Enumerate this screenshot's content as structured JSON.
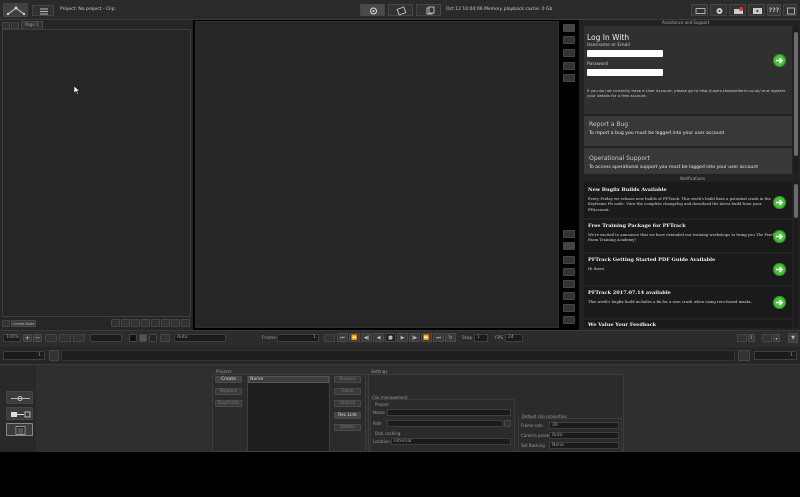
{
  "title_bar": {
    "project_label": "Project: No project - Clip:",
    "status": "Oct 12 10:04:06 Memory playback cache: 0 Gb"
  },
  "left_panel": {
    "tab_label": "Page 1",
    "create_button": "Create Node"
  },
  "side_panel": {
    "header_top": "Assistance and Support",
    "login": {
      "title": "Log In With",
      "username_label": "Username or Email",
      "password_label": "Password",
      "info_text": "If you do not currently have a User Account, please go to http://users.thepixelfarm.co.uk/ and register your details for a free account."
    },
    "report_bug": {
      "title": "Report a Bug",
      "text": "To report a bug you must be logged into your user account"
    },
    "op_support": {
      "title": "Operational Support",
      "text": "To access operational support you must be logged into your user account"
    },
    "header_notifications": "Notifications",
    "notifications": [
      {
        "title": "New Bugfix Builds Available",
        "body": "Every Friday we release new builds of PFTrack. This week's build fixes a potential crash in the Keyframe Fit node. View the complete changelog and download the latest build from your PFAccount."
      },
      {
        "title": "Free Training Package for PFTrack",
        "body": "We're excited to announce that we have extended our training workshops to bring you The Pixel Farm Training Academy!"
      },
      {
        "title": "PFTrack Getting Started PDF Guide Available",
        "body": "Hi there,"
      },
      {
        "title": "PFTrack 2017.07.14 available",
        "body": "This week's bugfix build includes a fix for a rare crash when using roto-based masks."
      },
      {
        "title": "We Value Your Feedback",
        "body": ""
      }
    ]
  },
  "playback_bar": {
    "zoom": "100%",
    "mode_select": "Auto",
    "frame_label": "Frame",
    "frame_value": "1",
    "step_label": "Step",
    "step_value": "1",
    "fps_label": "FPS",
    "fps_value": "24"
  },
  "timeline": {
    "start": "1",
    "end": "1"
  },
  "projects": {
    "header": "Projects",
    "create": "Create",
    "replace": "Replace",
    "duplicate": "Duplicate",
    "name_header": "Name",
    "open": "Browse",
    "close": "Close",
    "unlock": "Unlock",
    "recent_links": "Rec.Link",
    "delete": "Delete"
  },
  "settings": {
    "header": "Settings",
    "clip_management": "Clip management",
    "project": "Project",
    "name_label": "Name",
    "path_label": "Path",
    "disk_caching": "Disk caching",
    "location_label": "Location",
    "location_value": "Internal",
    "default_clip_props": "Default clip properties",
    "frame_rate_label": "Frame rate",
    "frame_rate_value": "30",
    "camera_preset_label": "Camera preset",
    "camera_preset_value": "Auto",
    "set_backing_label": "Set Backing",
    "set_backing_value": "None"
  },
  "colors": {
    "accent_green": "#46c33a",
    "panel_bg": "#2b2b2b",
    "viewer_bg": "#262626"
  }
}
